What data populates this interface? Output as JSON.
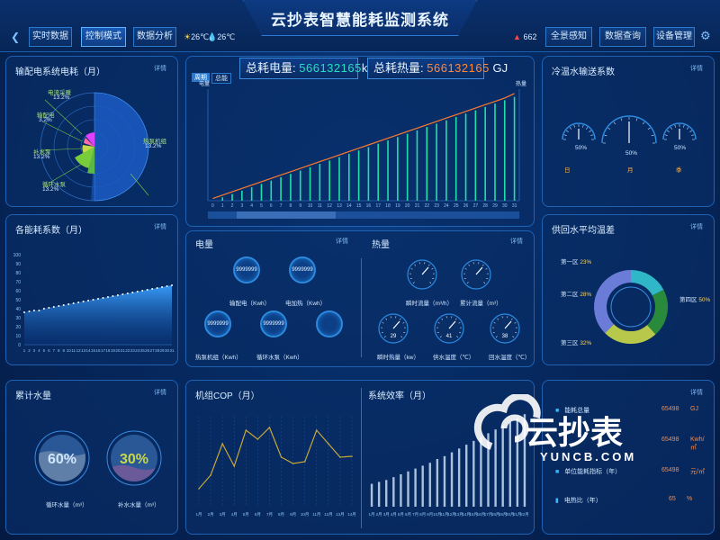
{
  "header": {
    "title": "云抄表智慧能耗监测系统",
    "left_nav": [
      "实时数据",
      "控制模式",
      "数据分析"
    ],
    "active_nav": 1,
    "temps": [
      "26℃",
      "26℃"
    ],
    "alarm_count": "662",
    "right_nav": [
      "全景感知",
      "数据查询",
      "设备管理"
    ]
  },
  "common": {
    "detail": "详情"
  },
  "totals": {
    "power_label": "总耗电量:",
    "power_value": "566132165",
    "power_unit": "kwh",
    "heat_label": "总耗热量:",
    "heat_value": "566132165",
    "heat_unit": "GJ"
  },
  "panels": {
    "distribution": {
      "title": "输配电系统电耗（月）",
      "items": [
        {
          "name": "电流采暖",
          "value": "13.2%"
        },
        {
          "name": "输配电",
          "value": "3.2%"
        },
        {
          "name": "补水泵",
          "value": "13.2%"
        },
        {
          "name": "循环水泵",
          "value": "13.2%"
        },
        {
          "name": "热泵机组",
          "value": "13.2%"
        }
      ]
    },
    "energy_system": {
      "title": "各能耗系数（月）"
    },
    "cold_water": {
      "title": "冷温水输送系数",
      "gauges": [
        {
          "label": "日",
          "value": "50%"
        },
        {
          "label": "月",
          "value": "50%"
        },
        {
          "label": "季",
          "value": "50%"
        }
      ]
    },
    "supply_return": {
      "title": "供回水平均温差",
      "items": [
        {
          "name": "第一区",
          "value": "23%"
        },
        {
          "name": "第二区",
          "value": "28%"
        },
        {
          "name": "第三区",
          "value": "32%"
        },
        {
          "name": "第四区",
          "value": "50%"
        }
      ]
    },
    "electric": {
      "title": "电量",
      "meters": [
        {
          "label": "输配电（Kwh）",
          "value": "9999999"
        },
        {
          "label": "电加热（Kwh）",
          "value": "9999999"
        },
        {
          "label": "热泵机组（Kwh）",
          "value": "9999999"
        },
        {
          "label": "循环水泵（Kwh）",
          "value": "9999999"
        },
        {
          "label": "",
          "value": ""
        }
      ]
    },
    "heat": {
      "title": "热量",
      "gauges": [
        {
          "label": "瞬时流量（m³/h）",
          "value": ""
        },
        {
          "label": "累计流量（m³）",
          "value": ""
        },
        {
          "label": "瞬时热量（kw）",
          "value": "29"
        },
        {
          "label": "供水温度（℃）",
          "value": "41"
        },
        {
          "label": "回水温度（℃）",
          "value": "38"
        }
      ]
    },
    "water": {
      "title": "累计水量",
      "items": [
        {
          "label": "循环水量（m³）",
          "value": "60%",
          "level": 0.6
        },
        {
          "label": "补水水量（m³）",
          "value": "30%",
          "level": 0.3
        }
      ]
    },
    "cop": {
      "title": "机组COP（月）"
    },
    "efficiency": {
      "title": "系统效率（月）"
    },
    "summary": {
      "items": [
        {
          "label": "能耗总量",
          "value": "65498",
          "unit": "GJ"
        },
        {
          "label": "",
          "value": "65498",
          "unit": "Kwh/㎡"
        },
        {
          "label": "单位能耗指标（年）",
          "value": "65498",
          "unit": "元/㎡"
        },
        {
          "label": "电热比（年）",
          "value": "65",
          "unit": "%"
        }
      ]
    }
  },
  "watermark": {
    "brand": "云抄表",
    "site": "YUNCB.COM"
  },
  "chart_data": [
    {
      "type": "bar",
      "name_key": "main",
      "tabs": [
        "周期",
        "总能"
      ],
      "x": [
        0,
        1,
        2,
        3,
        4,
        5,
        6,
        7,
        8,
        9,
        10,
        11,
        12,
        13,
        14,
        15,
        16,
        17,
        18,
        19,
        20,
        21,
        22,
        23,
        24,
        25,
        26,
        27,
        28,
        29,
        30,
        31
      ],
      "ylabel_left": "电量",
      "ylabel_right": "热量",
      "values": [
        0,
        3,
        6,
        9,
        12,
        15,
        18,
        21,
        24,
        27,
        30,
        33,
        36,
        39,
        42,
        45,
        48,
        51,
        54,
        57,
        60,
        63,
        66,
        69,
        72,
        75,
        78,
        81,
        84,
        87,
        90,
        93
      ],
      "line": [
        2,
        5,
        8,
        11,
        14,
        17,
        20,
        23,
        26,
        29,
        32,
        35,
        38,
        41,
        44,
        47,
        50,
        53,
        56,
        59,
        62,
        65,
        68,
        71,
        74,
        77,
        80,
        83,
        86,
        89,
        92,
        96
      ],
      "ylim": [
        0,
        100
      ]
    },
    {
      "type": "area",
      "name_key": "energy",
      "x": [
        1,
        2,
        3,
        4,
        5,
        6,
        7,
        8,
        9,
        10,
        11,
        12,
        13,
        14,
        15,
        16,
        17,
        18,
        19,
        20,
        21,
        22,
        23,
        24,
        25,
        26,
        27,
        28,
        29,
        30,
        31
      ],
      "y_ticks": [
        0,
        10,
        20,
        30,
        40,
        50,
        60,
        70,
        80,
        90,
        100
      ],
      "values": [
        36,
        37,
        38,
        38,
        40,
        41,
        42,
        43,
        44,
        45,
        46,
        47,
        48,
        49,
        50,
        51,
        52,
        53,
        54,
        55,
        56,
        57,
        58,
        59,
        60,
        61,
        62,
        63,
        64,
        65,
        66
      ],
      "ylim": [
        0,
        100
      ]
    },
    {
      "type": "line",
      "name_key": "cop",
      "x": [
        "1月",
        "2月",
        "3月",
        "4月",
        "5月",
        "6月",
        "7月",
        "8月",
        "9月",
        "10月",
        "11月",
        "12月",
        "13月",
        "14月"
      ],
      "values": [
        20,
        35,
        70,
        45,
        85,
        75,
        88,
        55,
        48,
        50,
        85,
        70,
        55,
        56
      ],
      "ylim": [
        0,
        100
      ]
    },
    {
      "type": "bar",
      "name_key": "efficiency",
      "x": [
        "1月",
        "2月",
        "3月",
        "4月",
        "5月",
        "6月",
        "7月",
        "8月",
        "9月",
        "10月",
        "11月",
        "12月",
        "13月",
        "14月",
        "15月",
        "16月",
        "17月",
        "18月",
        "19月",
        "20月",
        "21月",
        "22月"
      ],
      "values": [
        24,
        26,
        28,
        31,
        34,
        37,
        40,
        43,
        46,
        50,
        53,
        57,
        61,
        65,
        69,
        73,
        77,
        81,
        85,
        89,
        93,
        97
      ],
      "ylim": [
        0,
        100
      ]
    }
  ]
}
